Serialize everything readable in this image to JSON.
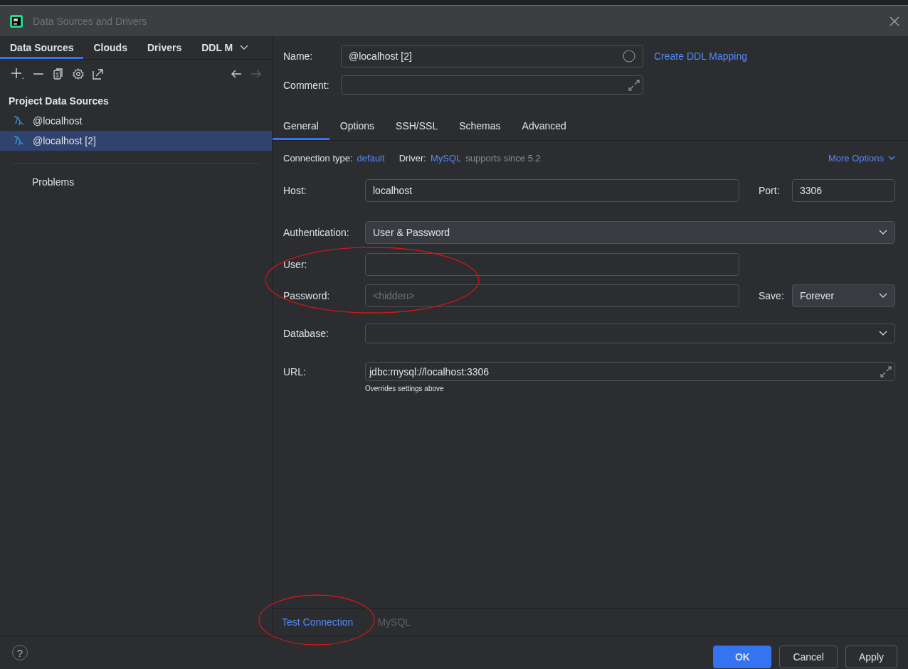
{
  "window": {
    "title": "Data Sources and Drivers"
  },
  "left_tabs": [
    {
      "label": "Data Sources",
      "selected": true
    },
    {
      "label": "Clouds",
      "selected": false
    },
    {
      "label": "Drivers",
      "selected": false
    },
    {
      "label": "DDL M",
      "selected": false
    }
  ],
  "sidebar": {
    "heading": "Project Data Sources",
    "items": [
      {
        "label": "@localhost",
        "selected": false
      },
      {
        "label": "@localhost [2]",
        "selected": true
      }
    ],
    "problems": "Problems"
  },
  "header": {
    "name_label": "Name:",
    "name_value": "@localhost [2]",
    "link": "Create DDL Mapping",
    "comment_label": "Comment:"
  },
  "tabs": [
    {
      "label": "General",
      "selected": true
    },
    {
      "label": "Options",
      "selected": false
    },
    {
      "label": "SSH/SSL",
      "selected": false
    },
    {
      "label": "Schemas",
      "selected": false
    },
    {
      "label": "Advanced",
      "selected": false
    }
  ],
  "connection": {
    "type_label": "Connection type:",
    "type_value": "default",
    "driver_label": "Driver:",
    "driver_value": "MySQL",
    "driver_note": "supports since 5.2",
    "more": "More Options"
  },
  "fields": {
    "host_label": "Host:",
    "host": "localhost",
    "port_label": "Port:",
    "port": "3306",
    "auth_label": "Authentication:",
    "auth": "User & Password",
    "user_label": "User:",
    "password_label": "Password:",
    "password_placeholder": "<hidden>",
    "save_label": "Save:",
    "save": "Forever",
    "database_label": "Database:",
    "url_label": "URL:",
    "url": "jdbc:mysql://localhost:3306",
    "url_hint": "Overrides settings above"
  },
  "bottom_bar": {
    "test": "Test Connection",
    "driver": "MySQL"
  },
  "help": "?",
  "buttons": [
    {
      "label": "OK",
      "kind": "primary"
    },
    {
      "label": "Cancel",
      "kind": "secondary"
    },
    {
      "label": "Apply",
      "kind": "secondary"
    }
  ]
}
